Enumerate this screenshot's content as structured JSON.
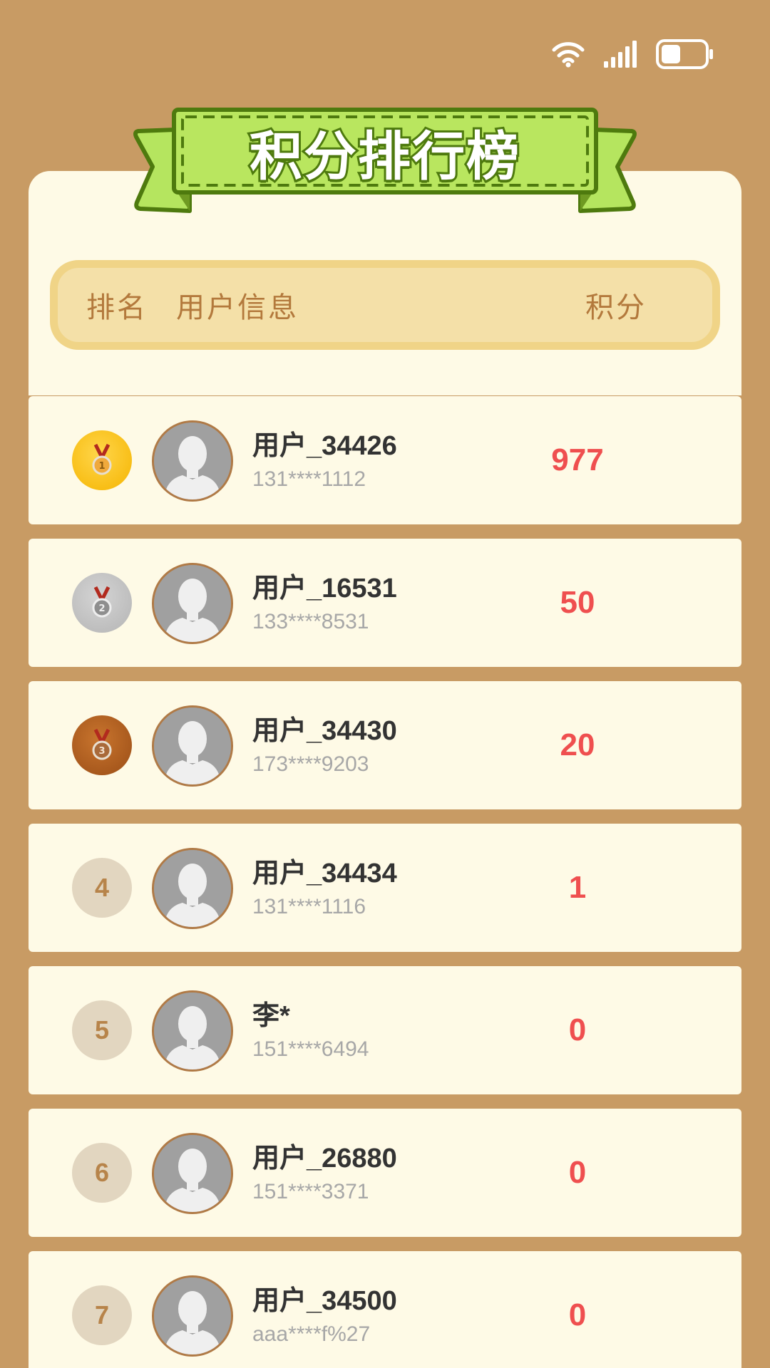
{
  "status_bar": {
    "wifi_icon": "wifi-icon",
    "signal_icon": "signal-icon",
    "battery_icon": "battery-icon",
    "battery_level": 0.45
  },
  "banner": {
    "title": "积分排行榜"
  },
  "table_header": {
    "rank": "排名",
    "user_info": "用户信息",
    "score": "积分"
  },
  "colors": {
    "background": "#c89b64",
    "card": "#fefae6",
    "score": "#ef4f4f",
    "banner_green": "#b5e55f"
  },
  "rows": [
    {
      "rank": "1",
      "medal": "gold",
      "name": "用户_34426",
      "phone": "131****1112",
      "score": "977"
    },
    {
      "rank": "2",
      "medal": "silver",
      "name": "用户_16531",
      "phone": "133****8531",
      "score": "50"
    },
    {
      "rank": "3",
      "medal": "bronze",
      "name": "用户_34430",
      "phone": "173****9203",
      "score": "20"
    },
    {
      "rank": "4",
      "medal": "",
      "name": "用户_34434",
      "phone": "131****1116",
      "score": "1"
    },
    {
      "rank": "5",
      "medal": "",
      "name": "李*",
      "phone": "151****6494",
      "score": "0"
    },
    {
      "rank": "6",
      "medal": "",
      "name": "用户_26880",
      "phone": "151****3371",
      "score": "0"
    },
    {
      "rank": "7",
      "medal": "",
      "name": "用户_34500",
      "phone": "aaa****f%27",
      "score": "0"
    }
  ]
}
